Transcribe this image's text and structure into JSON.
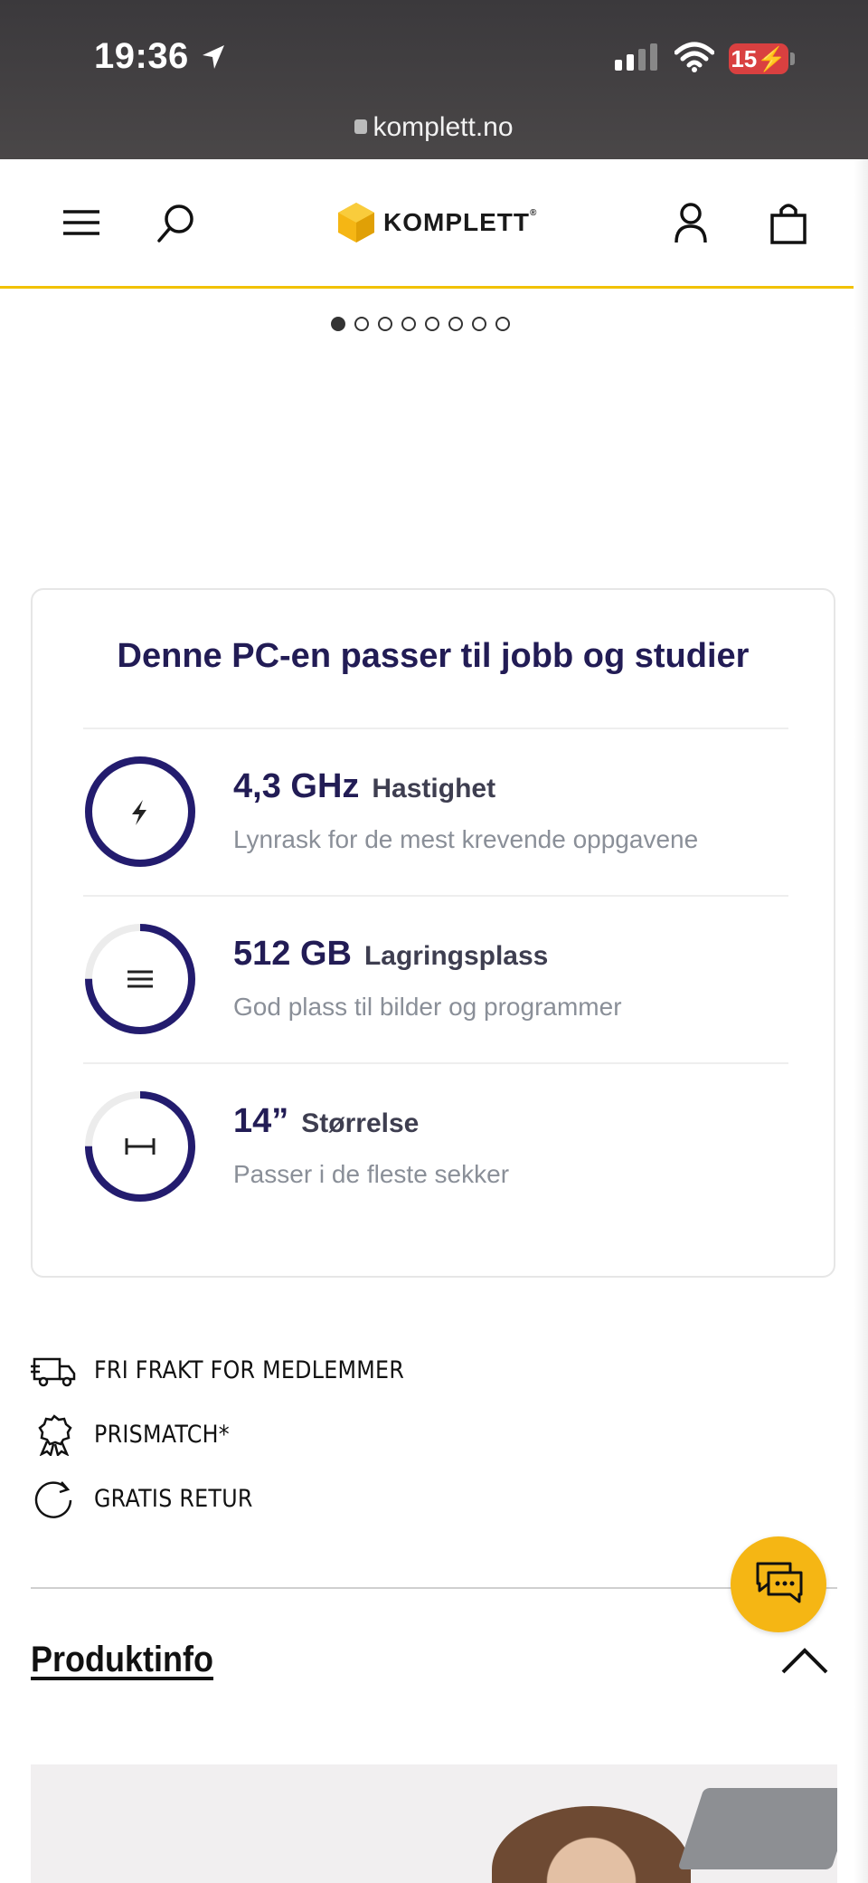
{
  "status_bar": {
    "time": "19:36",
    "battery": "15",
    "url": "komplett.no"
  },
  "header": {
    "brand": "KOMPLETT",
    "brand_mark": "®",
    "icons": [
      "menu-icon",
      "search-icon",
      "account-icon",
      "cart-icon"
    ]
  },
  "carousel": {
    "total_slides": 8,
    "active_index": 0
  },
  "spec_card": {
    "title": "Denne PC-en passer til jobb og studier",
    "specs": [
      {
        "value": "4,3 GHz",
        "label": "Hastighet",
        "description": "Lynrask for de mest krevende oppgavene",
        "icon": "lightning-icon",
        "fill_fraction": 1.0
      },
      {
        "value": "512 GB",
        "label": "Lagringsplass",
        "description": "God plass til bilder og programmer",
        "icon": "storage-icon",
        "fill_fraction": 0.75
      },
      {
        "value": "14”",
        "label": "Størrelse",
        "description": "Passer i de fleste sekker",
        "icon": "size-icon",
        "fill_fraction": 0.75
      }
    ],
    "accent_color": "#231c6e",
    "track_color": "#ececec"
  },
  "usps": [
    {
      "text": "FRI FRAKT FOR MEDLEMMER",
      "icon": "truck-icon"
    },
    {
      "text": "PRISMATCH*",
      "icon": "badge-icon"
    },
    {
      "text": "GRATIS RETUR",
      "icon": "return-icon"
    }
  ],
  "produktinfo": {
    "heading": "Produktinfo"
  },
  "colors": {
    "brand_yellow": "#f2c200",
    "chat_button": "#f5b614",
    "navy": "#221c55"
  }
}
